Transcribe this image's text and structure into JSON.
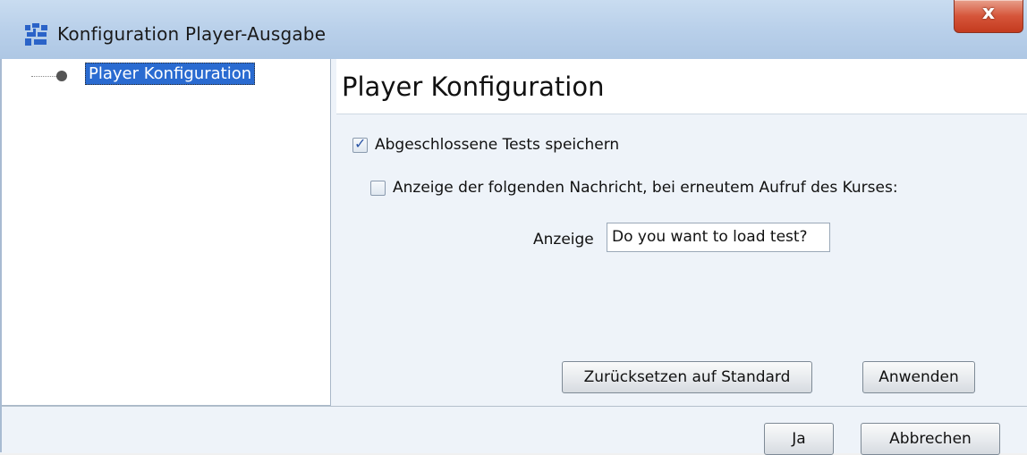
{
  "window": {
    "title": "Konfiguration Player-Ausgabe",
    "close_label": "x",
    "icon": "app-logo-icon"
  },
  "tree": {
    "items": [
      {
        "label": "Player Konfiguration",
        "selected": true
      }
    ]
  },
  "panel": {
    "title": "Player Konfiguration",
    "save_tests": {
      "label": "Abgeschlossene Tests speichern",
      "checked": true
    },
    "show_message": {
      "label": "Anzeige der folgenden Nachricht, bei erneutem Aufruf des Kurses:",
      "checked": false
    },
    "display_label": "Anzeige",
    "display_value": "Do you want to load test?",
    "reset_button": "Zurücksetzen auf Standard",
    "apply_button": "Anwenden"
  },
  "footer": {
    "ok_button": "Ja",
    "cancel_button": "Abbrechen"
  },
  "colors": {
    "selection": "#2a6bd1",
    "close_button": "#d6553a",
    "panel_bg": "#eef3f9"
  }
}
